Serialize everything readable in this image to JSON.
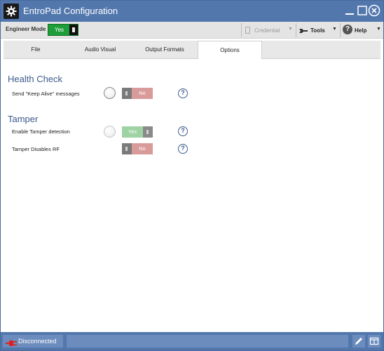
{
  "window": {
    "title": "EntroPad Configuration"
  },
  "toolbar": {
    "engineer_mode_label": "Engineer Mode",
    "engineer_mode_value": "Yes",
    "credential_label": "Credential",
    "tools_label": "Tools",
    "help_label": "Help"
  },
  "tabs": [
    {
      "label": "File"
    },
    {
      "label": "Audio Visual"
    },
    {
      "label": "Output Formats"
    },
    {
      "label": "Options"
    }
  ],
  "options": {
    "health_check": {
      "title": "Health Check",
      "keep_alive_label": "Send \"Keep Alive\" messages",
      "keep_alive_value": "No"
    },
    "tamper": {
      "title": "Tamper",
      "enable_label": "Enable Tamper detection",
      "enable_value": "Yes",
      "disables_rf_label": "Tamper Disables RF",
      "disables_rf_value": "No"
    },
    "help_glyph": "?"
  },
  "status": {
    "connection": "Disconnected"
  },
  "colors": {
    "titlebar": "#5277ad",
    "accent_text": "#3c5a8c",
    "toggle_yes_active": "#1e9e3a",
    "toggle_no": "#d99a9a",
    "toggle_yes_faint": "#9fd3a3"
  },
  "icons": {
    "app": "gear-icon",
    "minimize": "minimize-icon",
    "maximize": "maximize-icon",
    "close": "close-icon",
    "credential": "card-icon",
    "tools": "wrench-icon",
    "help": "help-icon",
    "connection": "plug-icon",
    "edit": "pencil-icon",
    "layout": "window-icon"
  }
}
